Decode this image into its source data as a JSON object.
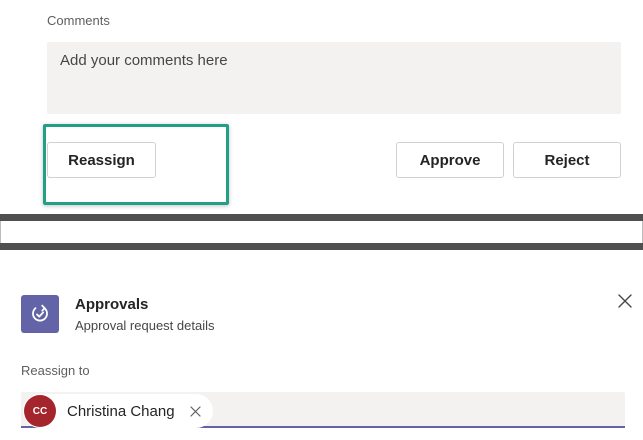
{
  "comments": {
    "label": "Comments",
    "placeholder": "Add your comments here"
  },
  "actions": {
    "reassign_label": "Reassign",
    "approve_label": "Approve",
    "reject_label": "Reject"
  },
  "approvals_dialog": {
    "title": "Approvals",
    "subtitle": "Approval request details",
    "icon": "approvals-icon",
    "close_icon": "close-icon",
    "reassign_to_label": "Reassign to",
    "selected_person": {
      "initials": "CC",
      "name": "Christina Chang",
      "avatar_color": "#a4262c"
    }
  },
  "colors": {
    "accent": "#6264a7",
    "highlight": "#22a087",
    "separator": "#505050"
  }
}
